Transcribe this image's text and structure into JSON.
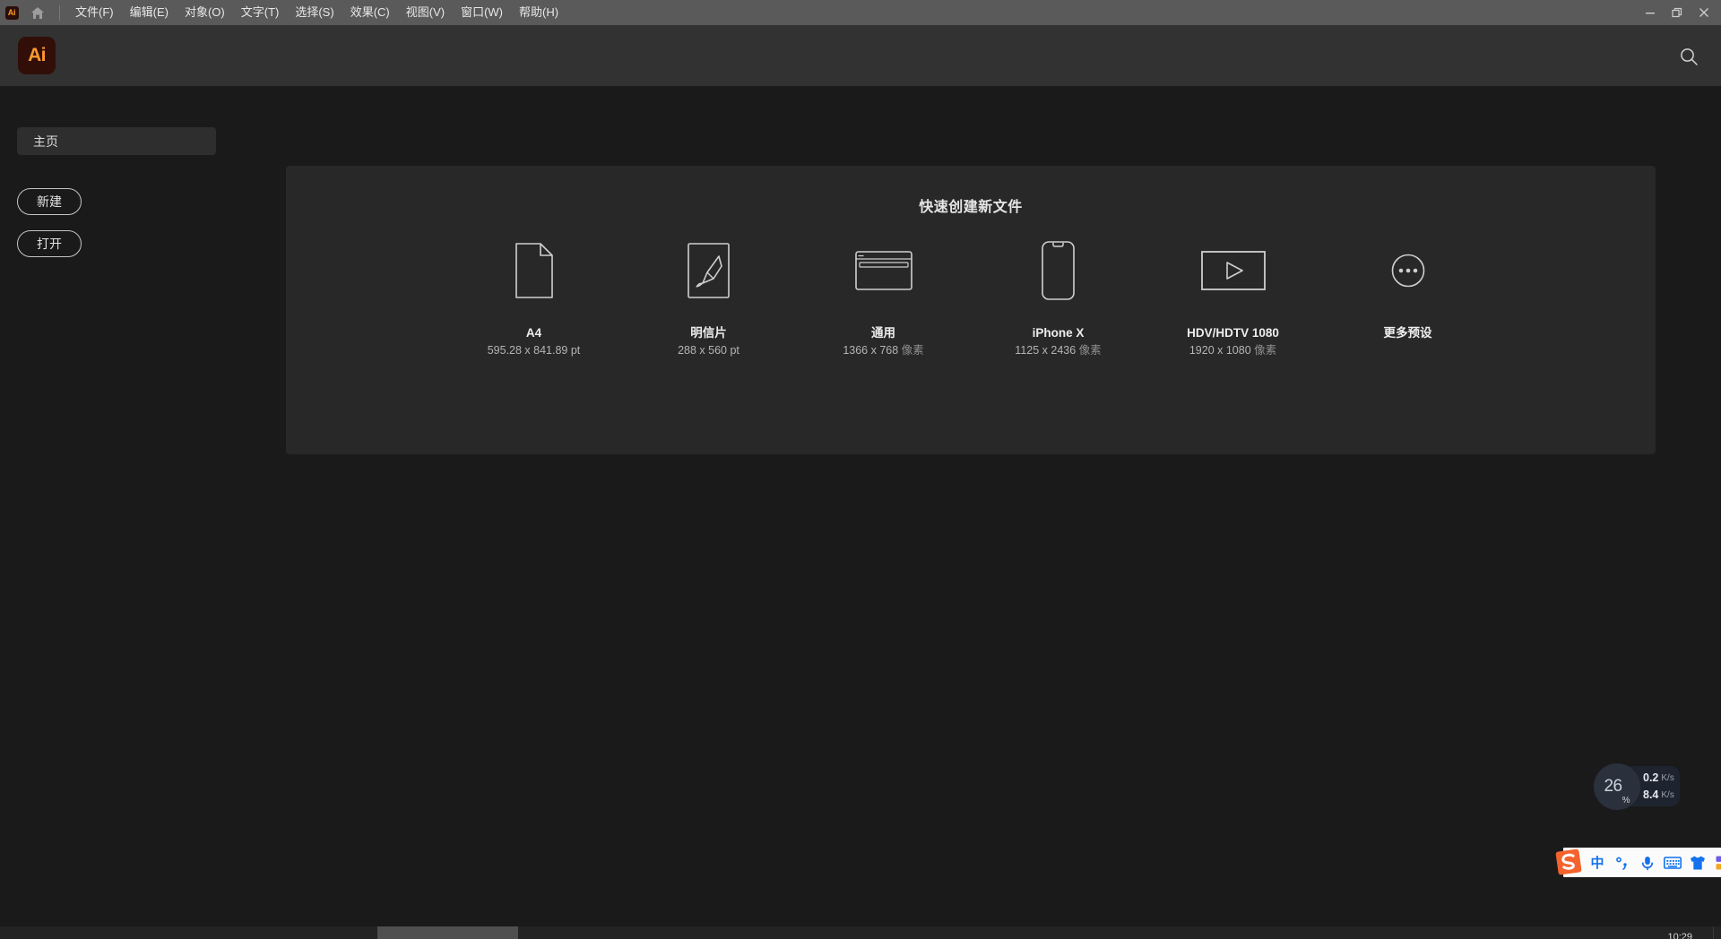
{
  "window": {
    "app_logo_text": "Ai",
    "menu_items": [
      {
        "label": "文件(F)",
        "name": "menu-file"
      },
      {
        "label": "编辑(E)",
        "name": "menu-edit"
      },
      {
        "label": "对象(O)",
        "name": "menu-object"
      },
      {
        "label": "文字(T)",
        "name": "menu-type"
      },
      {
        "label": "选择(S)",
        "name": "menu-select"
      },
      {
        "label": "效果(C)",
        "name": "menu-effect"
      },
      {
        "label": "视图(V)",
        "name": "menu-view"
      },
      {
        "label": "窗口(W)",
        "name": "menu-window"
      },
      {
        "label": "帮助(H)",
        "name": "menu-help"
      }
    ],
    "controls": {
      "minimize": "minimize",
      "restore": "restore",
      "close": "close"
    },
    "home_icon": "home-icon"
  },
  "header": {
    "brand": "Ai",
    "search_icon": "search-icon"
  },
  "sidebar": {
    "nav_item": "主页",
    "buttons": [
      {
        "label": "新建",
        "name": "new-button"
      },
      {
        "label": "打开",
        "name": "open-button"
      }
    ]
  },
  "main": {
    "title": "快速创建新文件",
    "presets": [
      {
        "name": "A4",
        "size": "595.28 x 841.89 pt",
        "unit": "",
        "icon": "document-page-icon"
      },
      {
        "name": "明信片",
        "size": "288 x 560 pt",
        "unit": "",
        "icon": "paintbrush-icon"
      },
      {
        "name": "通用",
        "size": "1366 x 768",
        "unit": "像素",
        "icon": "browser-window-icon"
      },
      {
        "name": "iPhone X",
        "size": "1125 x 2436",
        "unit": "像素",
        "icon": "phone-icon"
      },
      {
        "name": "HDV/HDTV 1080",
        "size": "1920 x 1080",
        "unit": "像素",
        "icon": "video-play-icon"
      },
      {
        "name": "更多预设",
        "size": "",
        "unit": "",
        "icon": "ellipsis-circle-icon"
      }
    ]
  },
  "net_widget": {
    "percent": "26",
    "percent_symbol": "%",
    "upload_value": "0.2",
    "upload_unit": "K/s",
    "upload_arrow": "↑",
    "download_value": "8.4",
    "download_unit": "K/s",
    "download_arrow": "↓",
    "arc_color": "#3ecfb2"
  },
  "ime": {
    "logo": "sogou-logo",
    "items": [
      {
        "label": "中",
        "name": "ime-language-toggle"
      },
      {
        "label": "",
        "name": "ime-punctuation-icon"
      },
      {
        "label": "",
        "name": "ime-microphone-icon"
      },
      {
        "label": "",
        "name": "ime-keyboard-icon"
      },
      {
        "label": "",
        "name": "ime-skin-icon"
      },
      {
        "label": "",
        "name": "ime-toolbox-icon"
      }
    ]
  },
  "taskbar": {
    "clock": "10:29"
  }
}
